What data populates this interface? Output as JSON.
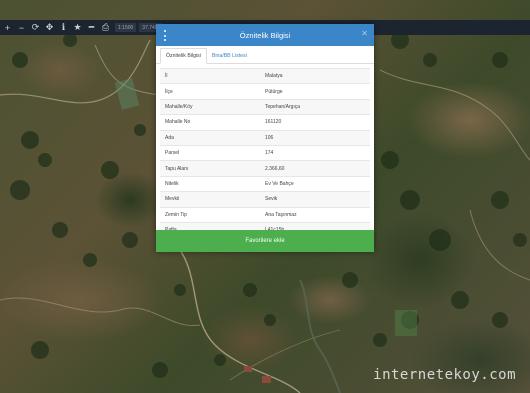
{
  "toolbar": {
    "tools": [
      {
        "icon": "plus-icon",
        "glyph": "+"
      },
      {
        "icon": "minus-icon",
        "glyph": "−"
      },
      {
        "icon": "refresh-icon",
        "glyph": "⟳"
      },
      {
        "icon": "move-icon",
        "glyph": "✥"
      },
      {
        "icon": "info-icon",
        "glyph": "ℹ"
      },
      {
        "icon": "star-icon",
        "glyph": "★"
      },
      {
        "icon": "ruler-icon",
        "glyph": "━"
      },
      {
        "icon": "print-icon",
        "glyph": "⎙"
      }
    ],
    "scale_label": "1:1500",
    "coord_label": "37.7480"
  },
  "dialog": {
    "title": "Öznitelik Bilgisi",
    "tabs": [
      "Öznitelik Bilgisi",
      "Bina/BB Listesi"
    ],
    "rows": [
      {
        "key": "İl",
        "value": "Malatya"
      },
      {
        "key": "İlçe",
        "value": "Pütürge"
      },
      {
        "key": "Mahalle/Köy",
        "value": "Tepehan/Argıça"
      },
      {
        "key": "Mahalle No",
        "value": "161120"
      },
      {
        "key": "Ada",
        "value": "106"
      },
      {
        "key": "Parsel",
        "value": "174"
      },
      {
        "key": "Tapu Alanı",
        "value": "2.366,60"
      },
      {
        "key": "Nitelik",
        "value": "Ev Ve Bahçe"
      },
      {
        "key": "Mevkii",
        "value": "Sevik"
      },
      {
        "key": "Zemin Tip",
        "value": "Ana Taşınmaz"
      },
      {
        "key": "Pafta",
        "value": "L41c15b"
      }
    ],
    "favorite_button": "Favorilere ekle"
  },
  "watermark": "internetekoy.com",
  "colors": {
    "header": "#3a86c8",
    "button": "#4cae4c",
    "toolbar": "#1c2430"
  }
}
